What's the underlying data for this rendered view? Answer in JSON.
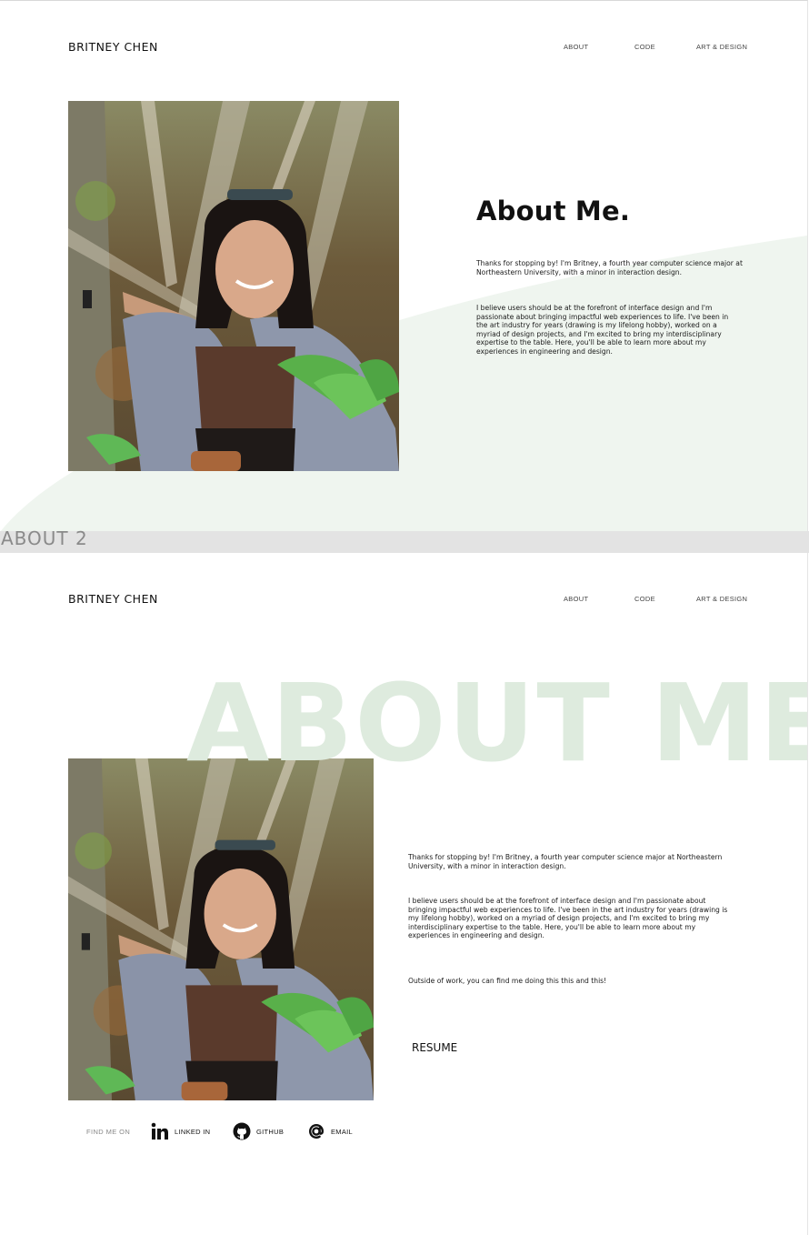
{
  "frame1": {
    "brand": "BRITNEY CHEN",
    "nav": [
      "ABOUT",
      "CODE",
      "ART & DESIGN"
    ],
    "title": "About Me.",
    "paragraph1": "Thanks for stopping by! I'm Britney, a fourth year computer science major at Northeastern University, with a minor in interaction design.",
    "paragraph2": "I believe users should be at the forefront of interface design and I'm passionate about bringing impactful web experiences to life. I've been in the art industry for years (drawing is my lifelong hobby), worked on a myriad of design projects, and I'm excited to bring my interdisciplinary expertise to the table. Here, you'll be able to learn more about my experiences in engineering and design."
  },
  "divider_label": "ABOUT 2",
  "frame2": {
    "brand": "BRITNEY CHEN",
    "nav": [
      "ABOUT",
      "CODE",
      "ART & DESIGN"
    ],
    "watermark": "ABOUT ME",
    "paragraph1": "Thanks for stopping by! I'm Britney, a fourth year computer science major at Northeastern University, with a minor in interaction design.",
    "paragraph2": "I believe users should be at the forefront of interface design and I'm passionate about bringing impactful web experiences to life. I've been in the art industry for years (drawing is my lifelong hobby), worked on a myriad of design projects, and I'm excited to bring my interdisciplinary expertise to the table. Here, you'll be able to learn more about my experiences in engineering and design.",
    "paragraph3": "Outside of work, you can find me doing this this and this!",
    "resume": "RESUME",
    "find_me": "FIND ME ON",
    "social": [
      {
        "label": "LINKED IN",
        "icon": "linkedin-icon"
      },
      {
        "label": "GITHUB",
        "icon": "github-icon"
      },
      {
        "label": "EMAIL",
        "icon": "at-sign-icon"
      }
    ]
  },
  "colors": {
    "accent_green": "#deebde",
    "wave_green": "#eff5ef",
    "divider_gray": "#e3e3e3"
  }
}
